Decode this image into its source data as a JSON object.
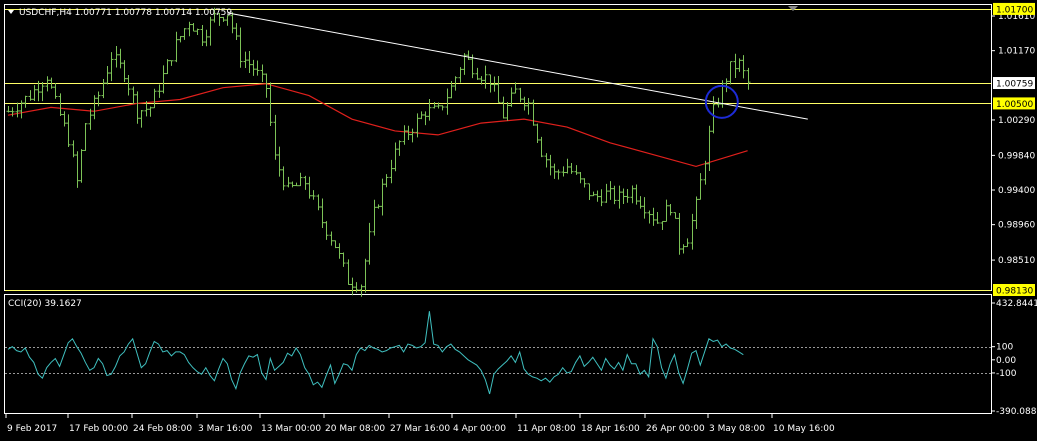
{
  "header": {
    "symbol_line": "USDCHF,H4  1.00771 1.00778 1.00714 1.00759",
    "menu_icon": "triangle-down-icon"
  },
  "indicator": {
    "label": "CCI(20) 39.1627"
  },
  "colors": {
    "background": "#000000",
    "candles": "#7cc257",
    "ma_line": "#e0201c",
    "trendline": "#ffffff",
    "hline": "#ffff66",
    "highlight_label_bg": "#ffff00",
    "circle": "#1d2bd6",
    "cci_line": "#3fbfbf",
    "axis": "#ffffff",
    "dotted_level": "#9a9a9a"
  },
  "chart_data": [
    {
      "type": "ohlc",
      "title": "USDCHF,H4",
      "ylim": [
        0.9813,
        1.0175
      ],
      "y_ticks": [
        "1.01610",
        "1.01170",
        "1.00290",
        "0.99840",
        "0.99400",
        "0.98960",
        "0.98510"
      ],
      "price_labels": [
        {
          "text": "1.01700",
          "value": 1.017,
          "highlight": true
        },
        {
          "text": "1.00759",
          "value": 1.00759,
          "highlight": false
        },
        {
          "text": "1.00500",
          "value": 1.005,
          "highlight": true
        },
        {
          "text": "0.98130",
          "value": 0.9813,
          "highlight": true
        }
      ],
      "horizontal_lines": [
        1.017,
        1.00759,
        1.005,
        0.9813
      ],
      "x_tick_labels": [
        "9 Feb 2017",
        "17 Feb 00:00",
        "24 Feb 08:00",
        "3 Mar 16:00",
        "13 Mar 00:00",
        "20 Mar 08:00",
        "27 Mar 16:00",
        "4 Apr 00:00",
        "11 Apr 08:00",
        "18 Apr 16:00",
        "26 Apr 00:00",
        "3 May 08:00",
        "10 May 16:00"
      ],
      "close_path": [
        [
          0,
          1.004
        ],
        [
          5,
          1.006
        ],
        [
          9,
          1.0085
        ],
        [
          11,
          1.005
        ],
        [
          14,
          1.0005
        ],
        [
          16,
          0.995
        ],
        [
          18,
          1.0025
        ],
        [
          21,
          1.006
        ],
        [
          24,
          1.011
        ],
        [
          27,
          1.009
        ],
        [
          30,
          1.004
        ],
        [
          33,
          1.0045
        ],
        [
          36,
          1.0085
        ],
        [
          39,
          1.0125
        ],
        [
          42,
          1.0155
        ],
        [
          45,
          1.0135
        ],
        [
          48,
          1.016
        ],
        [
          51,
          1.0165
        ],
        [
          54,
          1.011
        ],
        [
          57,
          1.0095
        ],
        [
          60,
          1.007
        ],
        [
          62,
          0.998
        ],
        [
          65,
          0.994
        ],
        [
          69,
          0.995
        ],
        [
          73,
          0.99
        ],
        [
          76,
          0.987
        ],
        [
          79,
          0.9825
        ],
        [
          82,
          0.982
        ],
        [
          85,
          0.991
        ],
        [
          88,
          0.996
        ],
        [
          91,
          1.0
        ],
        [
          94,
          1.002
        ],
        [
          97,
          1.004
        ],
        [
          100,
          1.004
        ],
        [
          103,
          1.007
        ],
        [
          106,
          1.011
        ],
        [
          109,
          1.009
        ],
        [
          112,
          1.008
        ],
        [
          115,
          1.0035
        ],
        [
          118,
          1.0065
        ],
        [
          121,
          1.005
        ],
        [
          124,
          0.999
        ],
        [
          127,
          0.996
        ],
        [
          130,
          0.997
        ],
        [
          133,
          0.995
        ],
        [
          136,
          0.993
        ],
        [
          139,
          0.9935
        ],
        [
          142,
          0.993
        ],
        [
          145,
          0.994
        ],
        [
          148,
          0.992
        ],
        [
          151,
          0.99
        ],
        [
          154,
          0.992
        ],
        [
          156,
          0.987
        ],
        [
          158,
          0.988
        ],
        [
          160,
          0.992
        ],
        [
          162,
          0.998
        ],
        [
          164,
          1.004
        ],
        [
          166,
          1.007
        ],
        [
          168,
          1.0095
        ],
        [
          170,
          1.01
        ],
        [
          172,
          1.00759
        ]
      ],
      "ma_path": [
        [
          0,
          1.0035
        ],
        [
          10,
          1.0045
        ],
        [
          20,
          1.004
        ],
        [
          30,
          1.005
        ],
        [
          40,
          1.0055
        ],
        [
          50,
          1.007
        ],
        [
          60,
          1.0075
        ],
        [
          70,
          1.006
        ],
        [
          80,
          1.003
        ],
        [
          90,
          1.0015
        ],
        [
          100,
          1.001
        ],
        [
          110,
          1.0025
        ],
        [
          120,
          1.003
        ],
        [
          130,
          1.002
        ],
        [
          140,
          1.0
        ],
        [
          150,
          0.9985
        ],
        [
          160,
          0.997
        ],
        [
          172,
          0.999
        ]
      ],
      "trendline": {
        "from": [
          51,
          1.0165
        ],
        "to": [
          186,
          1.003
        ]
      },
      "highlight_circle": {
        "at": [
          166,
          1.0052
        ]
      }
    },
    {
      "type": "line",
      "title": "CCI(20)",
      "ylim": [
        -390.0889,
        432.8441
      ],
      "y_ticks": [
        "432.8441",
        "100",
        "0.00",
        "-100",
        "-390.0889"
      ],
      "levels": [
        100,
        -100
      ],
      "values": [
        80,
        100,
        70,
        60,
        90,
        20,
        -20,
        -110,
        -140,
        -60,
        -20,
        10,
        -50,
        40,
        130,
        160,
        100,
        50,
        -20,
        -80,
        -60,
        10,
        -30,
        -120,
        -110,
        -50,
        30,
        60,
        120,
        160,
        50,
        -60,
        -30,
        60,
        140,
        120,
        60,
        70,
        30,
        60,
        60,
        40,
        -20,
        -60,
        -90,
        -110,
        -60,
        -120,
        -160,
        -70,
        10,
        -30,
        -150,
        -220,
        -100,
        -30,
        30,
        20,
        40,
        -100,
        -150,
        10,
        -80,
        -50,
        -20,
        50,
        30,
        90,
        40,
        -60,
        -110,
        -190,
        -170,
        -210,
        -120,
        -40,
        -180,
        -110,
        -30,
        -40,
        -80,
        40,
        90,
        70,
        110,
        90,
        80,
        60,
        70,
        90,
        100,
        110,
        60,
        120,
        110,
        90,
        100,
        130,
        370,
        120,
        110,
        60,
        100,
        120,
        80,
        60,
        30,
        0,
        -20,
        -40,
        -80,
        -150,
        -260,
        -110,
        -70,
        -40,
        -10,
        30,
        -20,
        60,
        -70,
        -110,
        -130,
        -140,
        -160,
        -140,
        -170,
        -130,
        -110,
        -60,
        -100,
        -90,
        -20,
        30,
        -50,
        -20,
        20,
        -30,
        -80,
        10,
        -40,
        -70,
        -20,
        -80,
        40,
        -30,
        -30,
        -110,
        -80,
        -130,
        160,
        100,
        -60,
        -140,
        -30,
        40,
        -100,
        -180,
        -70,
        50,
        70,
        -40,
        60,
        160,
        140,
        150,
        100,
        120,
        90,
        80,
        60,
        39
      ]
    }
  ]
}
